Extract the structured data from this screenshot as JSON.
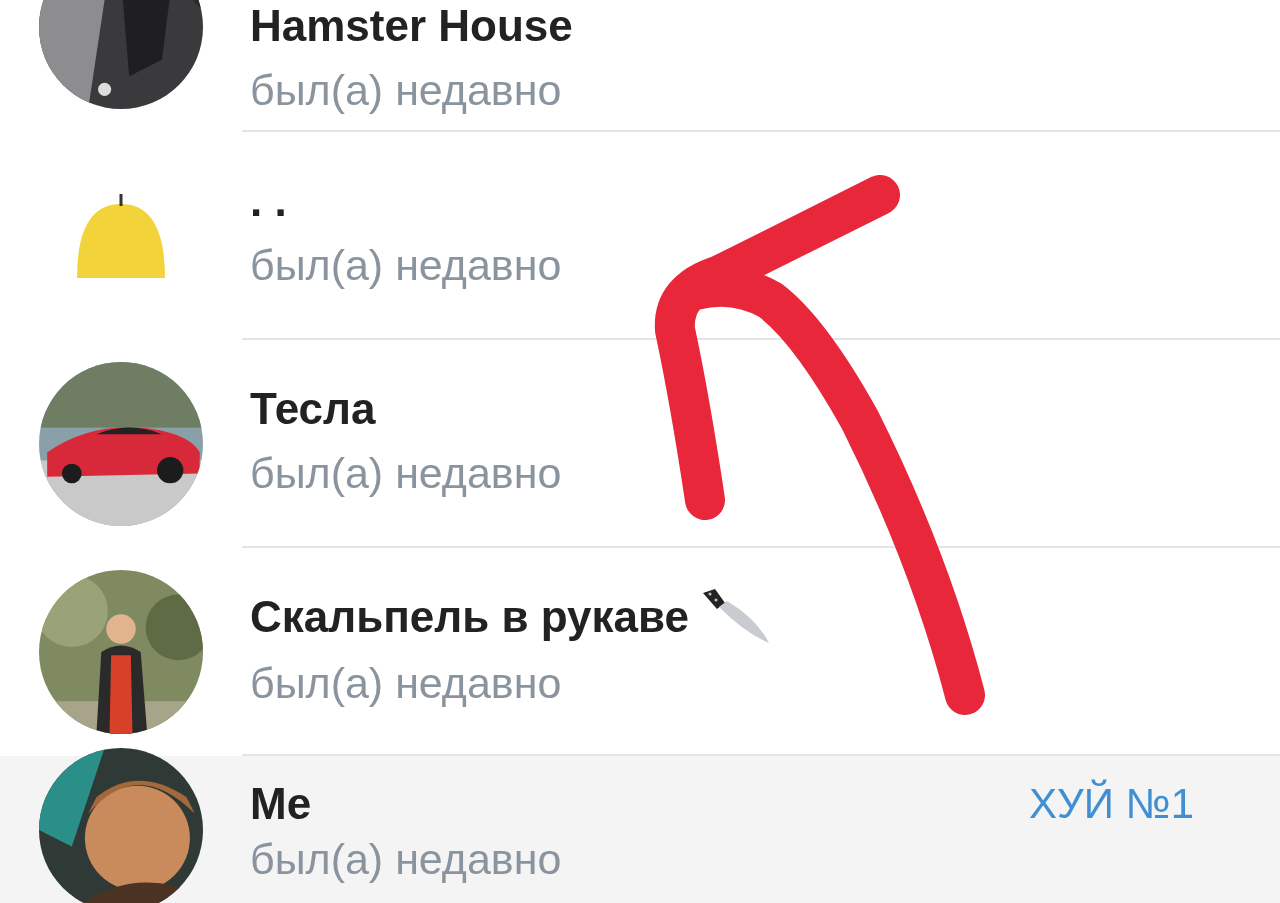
{
  "contacts": [
    {
      "name": "Hamster House",
      "status": "был(а) недавно"
    },
    {
      "name": ". .",
      "status": "был(а) недавно",
      "avatar": {
        "kind": "sticker"
      }
    },
    {
      "name": "Тесла",
      "status": "был(а) недавно"
    },
    {
      "name": "Скальпель в рукаве",
      "status": "был(а) недавно"
    },
    {
      "name": "Me",
      "status": "был(а) недавно",
      "tag": "ХУЙ №1"
    }
  ],
  "annotation": {
    "kind": "arrow"
  }
}
